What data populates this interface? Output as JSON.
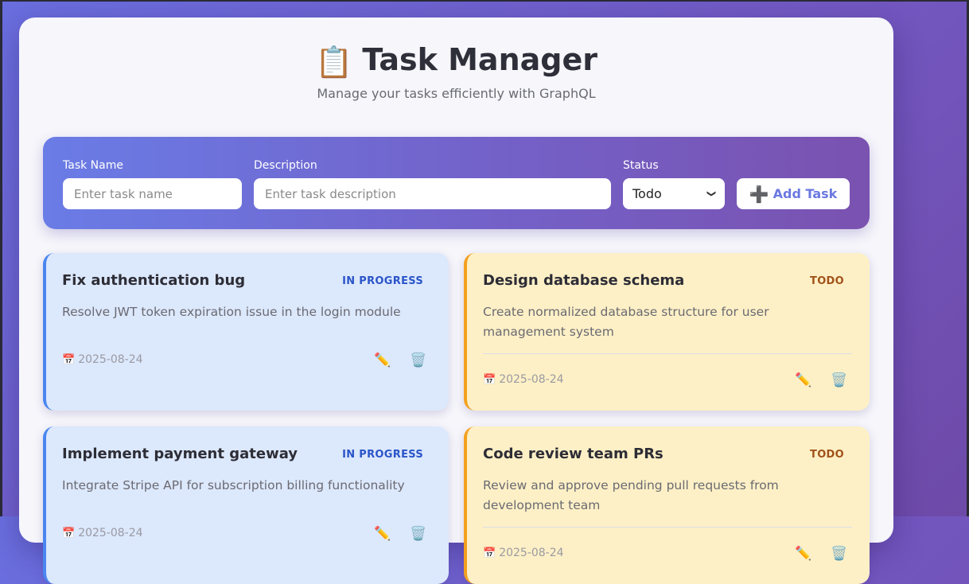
{
  "header": {
    "title": "Task Manager",
    "title_icon": "📋",
    "subtitle": "Manage your tasks efficiently with GraphQL"
  },
  "form": {
    "task_name_label": "Task Name",
    "task_name_placeholder": "Enter task name",
    "task_name_value": "",
    "description_label": "Description",
    "description_placeholder": "Enter task description",
    "description_value": "",
    "status_label": "Status",
    "status_selected": "Todo",
    "add_button_icon": "➕",
    "add_button_label": "Add Task"
  },
  "icons": {
    "calendar": "📅",
    "edit": "✏️",
    "delete": "🗑️",
    "select_chevron": "❯"
  },
  "colors": {
    "in_progress_bg": "#dce8fc",
    "in_progress_accent": "#4a86f0",
    "in_progress_badge": "#2a55c8",
    "todo_bg": "#fef0c6",
    "todo_accent": "#f4a020",
    "todo_badge": "#a0521a"
  },
  "tasks": [
    {
      "title": "Fix authentication bug",
      "status": "IN PROGRESS",
      "description": "Resolve JWT token expiration issue in the login module",
      "date": "2025-08-24"
    },
    {
      "title": "Design database schema",
      "status": "TODO",
      "description": "Create normalized database structure for user management system",
      "date": "2025-08-24"
    },
    {
      "title": "Implement payment gateway",
      "status": "IN PROGRESS",
      "description": "Integrate Stripe API for subscription billing functionality",
      "date": "2025-08-24"
    },
    {
      "title": "Code review team PRs",
      "status": "TODO",
      "description": "Review and approve pending pull requests from development team",
      "date": "2025-08-24"
    }
  ]
}
